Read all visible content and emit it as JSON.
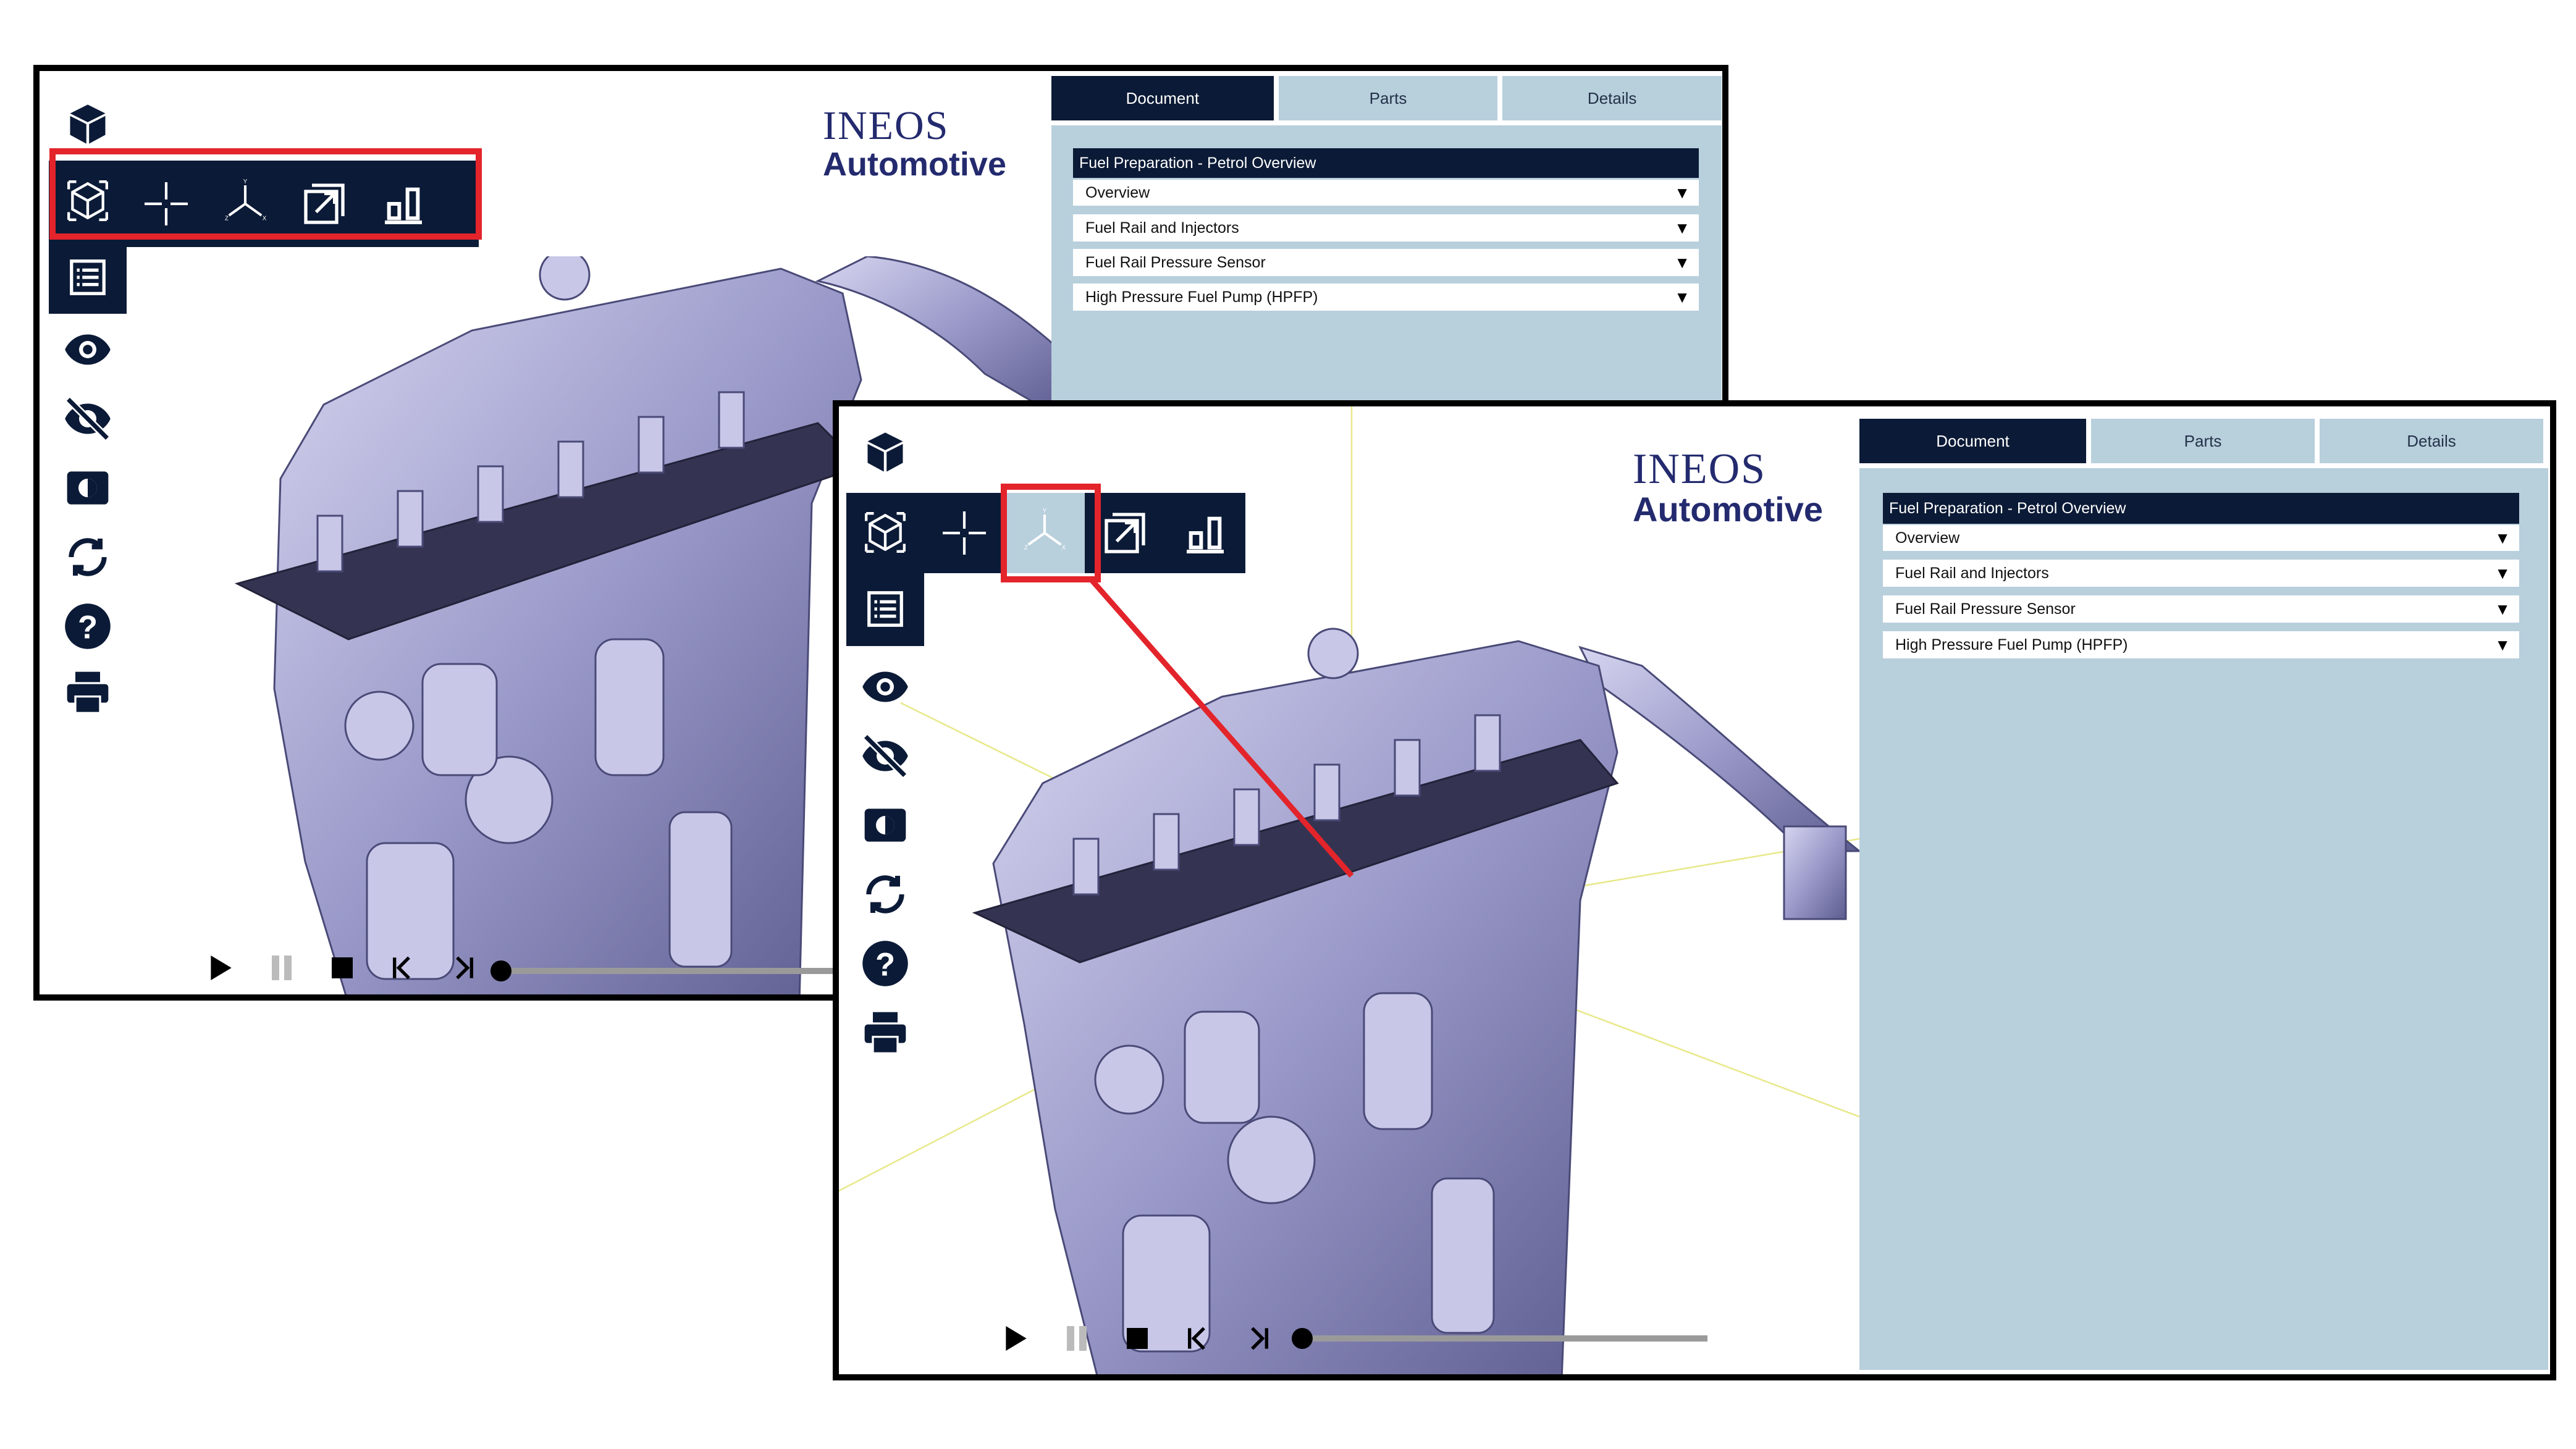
{
  "brand": {
    "line1": "INEOS",
    "line2": "Automotive",
    "color": "#232a6e"
  },
  "colors": {
    "navy": "#0b1a36",
    "panel": "#b8cfdc",
    "highlight": "#e3242b",
    "engine": "#a9a8d4"
  },
  "tabs": [
    {
      "label": "Document",
      "active": true
    },
    {
      "label": "Parts",
      "active": false
    },
    {
      "label": "Details",
      "active": false
    }
  ],
  "document": {
    "title": "Fuel Preparation - Petrol Overview",
    "items": [
      {
        "label": "Overview"
      },
      {
        "label": "Fuel Rail and Injectors"
      },
      {
        "label": "Fuel Rail Pressure Sensor"
      },
      {
        "label": "High Pressure Fuel Pump (HPFP)"
      }
    ],
    "expand_glyph": "▼"
  },
  "sidebar_icons": [
    "cube-icon",
    "view-cube-icon",
    "list-icon",
    "eye-icon",
    "eye-off-icon",
    "contrast-icon",
    "sync-icon",
    "help-icon",
    "print-icon"
  ],
  "view_toolbar_icons": [
    "view-cube-icon",
    "crosshair-icon",
    "axes-icon",
    "expand-icon",
    "chart-icon"
  ],
  "player_icons": [
    "play-icon",
    "pause-icon",
    "stop-icon",
    "skip-start-icon",
    "skip-end-icon"
  ],
  "active_tool_second_frame": "axes-icon"
}
